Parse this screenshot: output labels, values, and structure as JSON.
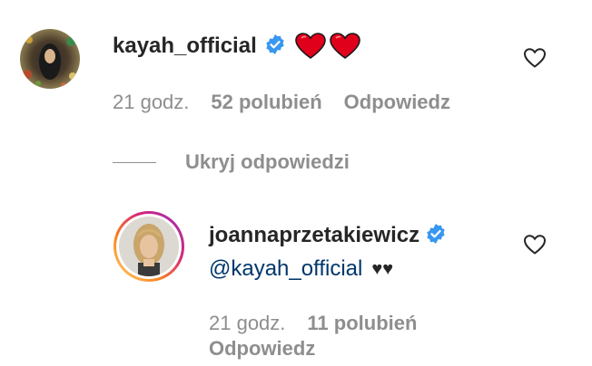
{
  "comment": {
    "username": "kayah_official",
    "text_emoji": "❤️❤️",
    "time": "21 godz.",
    "likes": "52 polubień",
    "reply": "Odpowiedz"
  },
  "replies_toggle": "Ukryj odpowiedzi",
  "reply_comment": {
    "username": "joannaprzetakiewicz",
    "mention": "@kayah_official",
    "text_emoji": "♥♥",
    "time": "21 godz.",
    "likes": "11 polubień",
    "reply": "Odpowiedz"
  },
  "colors": {
    "verified": "#3897f0",
    "mention": "#00376b",
    "meta": "#8e8e8e",
    "heart_red": "#e0001b"
  },
  "icons": {
    "verified": "verified-badge-icon",
    "like": "heart-outline-icon"
  }
}
